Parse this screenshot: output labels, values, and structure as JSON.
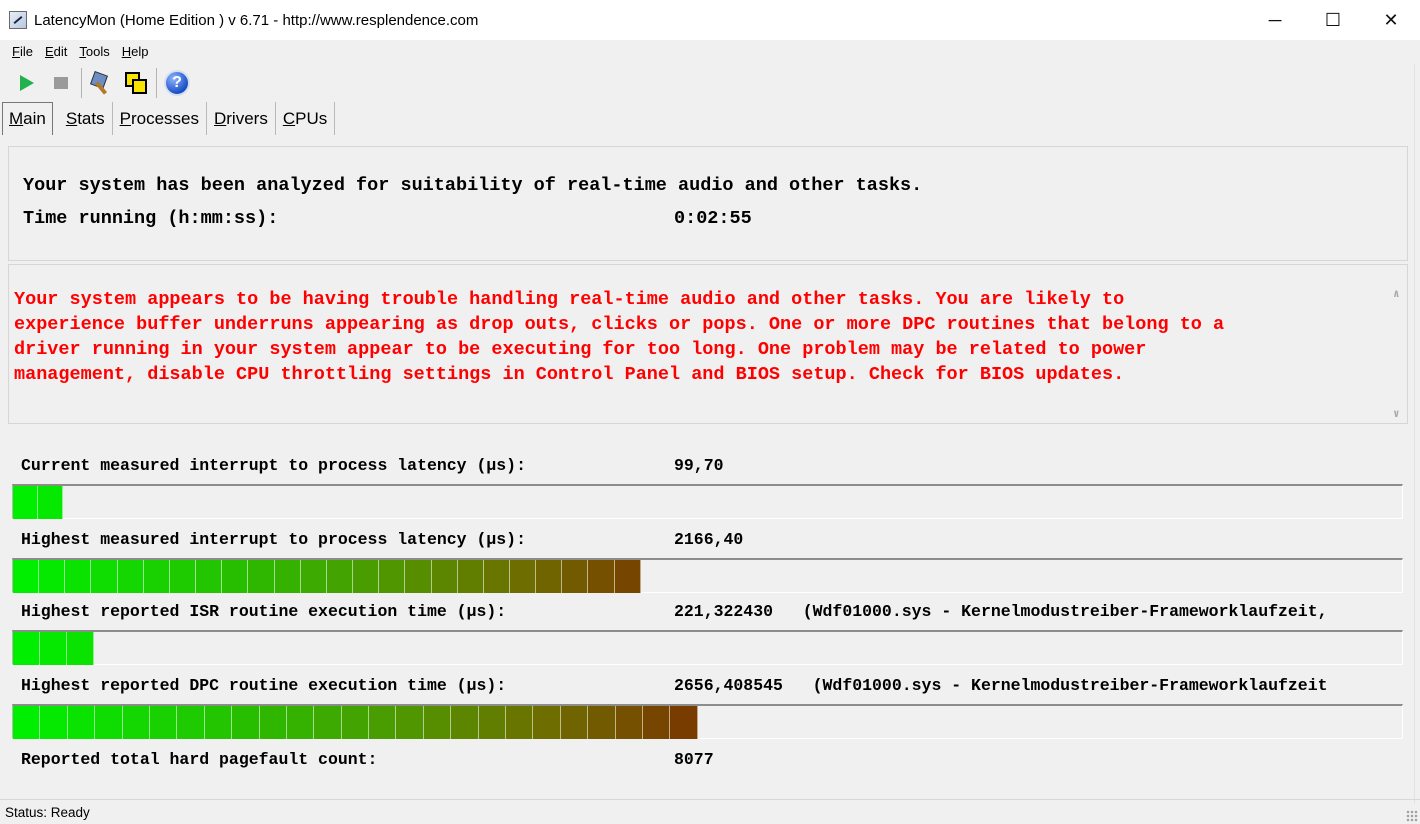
{
  "window": {
    "title": "LatencyMon  (Home Edition )  v 6.71 - http://www.resplendence.com",
    "minimize": "─",
    "maximize": "☐",
    "close": "✕"
  },
  "menu": {
    "items": [
      {
        "label": "File",
        "key": "F",
        "rest": "ile"
      },
      {
        "label": "Edit",
        "key": "E",
        "rest": "dit"
      },
      {
        "label": "Tools",
        "key": "T",
        "rest": "ools"
      },
      {
        "label": "Help",
        "key": "H",
        "rest": "elp"
      }
    ]
  },
  "toolbar": {
    "buttons": [
      "start-icon",
      "stop-icon",
      "tools-icon",
      "windows-icon",
      "help-icon"
    ],
    "help_glyph": "?"
  },
  "tabs": [
    {
      "key": "M",
      "rest": "ain",
      "active": true
    },
    {
      "key": "S",
      "rest": "tats",
      "active": false
    },
    {
      "key": "P",
      "rest": "rocesses",
      "active": false
    },
    {
      "key": "D",
      "rest": "rivers",
      "active": false
    },
    {
      "key": "C",
      "rest": "PUs",
      "active": false
    }
  ],
  "summary": {
    "headline": "Your system has been analyzed for suitability of real-time audio and other tasks.",
    "time_label": "Time running (h:mm:ss):",
    "time_value": "0:02:55"
  },
  "warning": {
    "color": "#ff0000",
    "text": "Your system appears to be having trouble handling real-time audio and other tasks. You are likely to\nexperience buffer underruns appearing as drop outs, clicks or pops. One or more DPC routines that belong to a\ndriver running in your system appear to be executing for too long. One problem may be related to power\nmanagement, disable CPU throttling settings in Control Panel and BIOS setup. Check for BIOS updates."
  },
  "metrics": [
    {
      "label": "Current measured interrupt to process latency (µs):",
      "value": "99,70",
      "bar_fraction": 0.036,
      "segments": 2
    },
    {
      "label": "Highest measured interrupt to process latency (µs):",
      "value": "2166,40",
      "bar_fraction": 0.452,
      "segments": 24
    },
    {
      "label": "Highest reported ISR routine execution time (µs):",
      "value": "221,322430   (Wdf01000.sys - Kernelmodustreiber-Frameworklaufzeit,",
      "bar_fraction": 0.058,
      "segments": 3
    },
    {
      "label": "Highest reported DPC routine execution time (µs):",
      "value": "2656,408545   (Wdf01000.sys - Kernelmodustreiber-Frameworklaufzeit",
      "bar_fraction": 0.493,
      "segments": 25
    },
    {
      "label": "Reported total hard pagefault count:",
      "value": "8077"
    }
  ],
  "status": {
    "text": "Status: Ready"
  }
}
